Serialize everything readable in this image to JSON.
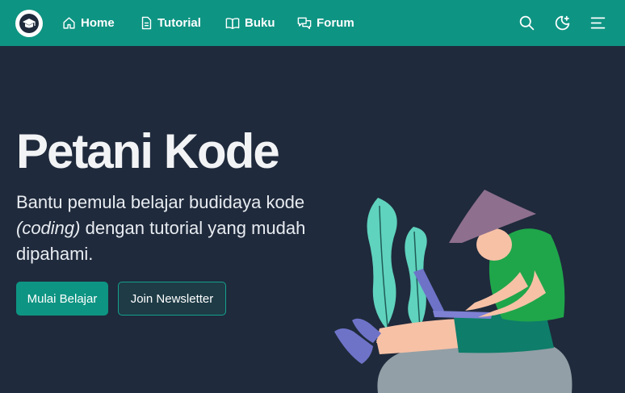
{
  "nav": {
    "items": [
      {
        "label": "Home",
        "icon": "home-icon"
      },
      {
        "label": "Tutorial",
        "icon": "document-icon"
      },
      {
        "label": "Buku",
        "icon": "book-icon"
      },
      {
        "label": "Forum",
        "icon": "chat-icon"
      }
    ],
    "actions": [
      "search-icon",
      "moon-icon",
      "menu-icon"
    ]
  },
  "hero": {
    "title": "Petani Kode",
    "desc_part1": "Bantu pemula belajar budidaya kode ",
    "desc_em": "(coding)",
    "desc_part2": " dengan tutorial yang mudah dipahami.",
    "primary_button": "Mulai Belajar",
    "secondary_button": "Join Newsletter"
  },
  "colors": {
    "brand": "#0e9483",
    "background": "#1f2a3c"
  }
}
